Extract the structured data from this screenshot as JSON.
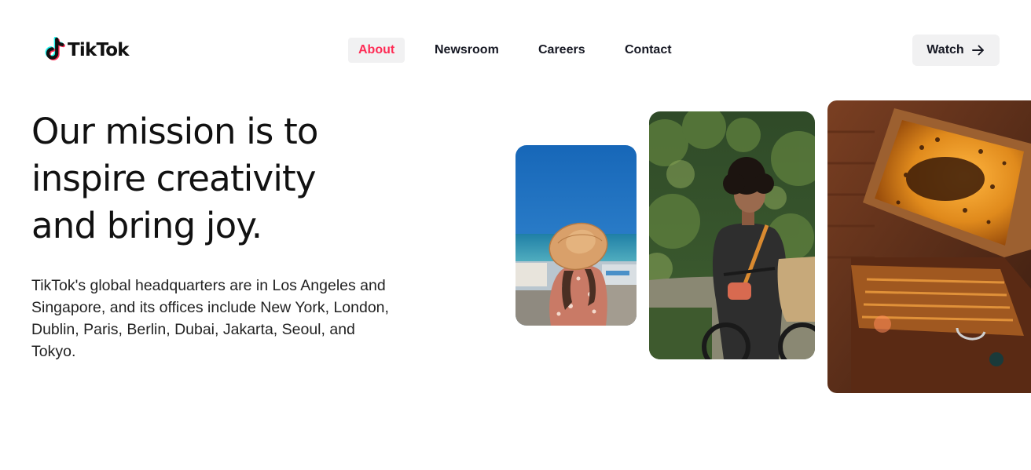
{
  "brand": {
    "name": "TikTok",
    "colors": {
      "cyan": "#25f4ee",
      "red": "#fe2c55",
      "ink": "#111111"
    }
  },
  "nav": {
    "items": [
      {
        "label": "About",
        "active": true
      },
      {
        "label": "Newsroom",
        "active": false
      },
      {
        "label": "Careers",
        "active": false
      },
      {
        "label": "Contact",
        "active": false
      }
    ]
  },
  "cta": {
    "label": "Watch",
    "icon": "arrow-right-icon"
  },
  "hero": {
    "heading": "Our mission is to inspire creativity and bring joy.",
    "body": "TikTok's global headquarters are in Los Angeles and Singapore, and its offices include New York, London, Dublin, Paris, Berlin, Dubai, Jakarta, Seoul, and Tokyo."
  }
}
